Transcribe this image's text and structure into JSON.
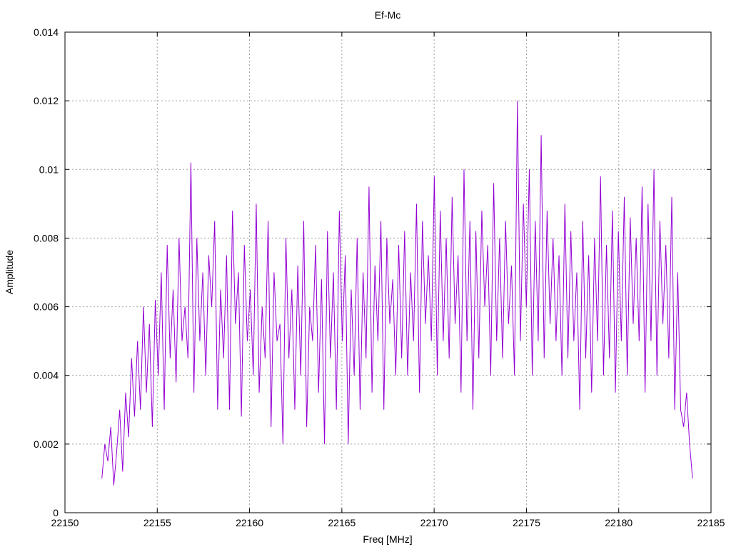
{
  "chart_data": {
    "type": "line",
    "title": "Ef-Mc",
    "xlabel": "Freq [MHz]",
    "ylabel": "Amplitude",
    "xlim": [
      22150,
      22185
    ],
    "ylim": [
      0,
      0.014
    ],
    "xticks": [
      22150,
      22155,
      22160,
      22165,
      22170,
      22175,
      22180,
      22185
    ],
    "yticks": [
      0,
      0.002,
      0.004,
      0.006,
      0.008,
      0.01,
      0.012,
      0.014
    ],
    "ytick_labels": [
      "0",
      "0.002",
      "0.004",
      "0.006",
      "0.008",
      "0.01",
      "0.012",
      "0.014"
    ],
    "grid": true,
    "series_color": "#9400d3",
    "x_range": [
      22152.0,
      22184.0
    ],
    "y": [
      0.001,
      0.002,
      0.0015,
      0.0025,
      0.0008,
      0.0018,
      0.003,
      0.0012,
      0.0035,
      0.0022,
      0.0045,
      0.0028,
      0.005,
      0.003,
      0.006,
      0.0035,
      0.0055,
      0.0025,
      0.0062,
      0.004,
      0.007,
      0.003,
      0.0078,
      0.0045,
      0.0065,
      0.0038,
      0.008,
      0.005,
      0.006,
      0.0045,
      0.0102,
      0.0035,
      0.008,
      0.005,
      0.007,
      0.004,
      0.0075,
      0.006,
      0.0085,
      0.003,
      0.0065,
      0.0045,
      0.0075,
      0.003,
      0.0088,
      0.0055,
      0.007,
      0.0028,
      0.0078,
      0.005,
      0.0065,
      0.004,
      0.009,
      0.0035,
      0.006,
      0.0045,
      0.0085,
      0.0025,
      0.007,
      0.005,
      0.0055,
      0.002,
      0.008,
      0.0045,
      0.0065,
      0.003,
      0.0072,
      0.004,
      0.0085,
      0.0025,
      0.006,
      0.005,
      0.0078,
      0.0035,
      0.0068,
      0.002,
      0.0082,
      0.0045,
      0.007,
      0.003,
      0.0088,
      0.005,
      0.0075,
      0.002,
      0.0065,
      0.004,
      0.008,
      0.003,
      0.007,
      0.0045,
      0.0095,
      0.0035,
      0.0072,
      0.005,
      0.0085,
      0.003,
      0.008,
      0.0055,
      0.0068,
      0.004,
      0.0078,
      0.0045,
      0.0082,
      0.004,
      0.007,
      0.005,
      0.009,
      0.0035,
      0.0085,
      0.0055,
      0.0075,
      0.005,
      0.0098,
      0.004,
      0.0088,
      0.005,
      0.008,
      0.0045,
      0.0092,
      0.0055,
      0.0075,
      0.0035,
      0.01,
      0.005,
      0.0085,
      0.003,
      0.0082,
      0.0045,
      0.0088,
      0.006,
      0.0078,
      0.004,
      0.0096,
      0.005,
      0.008,
      0.0045,
      0.0085,
      0.0055,
      0.0072,
      0.004,
      0.012,
      0.005,
      0.009,
      0.006,
      0.01,
      0.004,
      0.0085,
      0.005,
      0.011,
      0.0045,
      0.0088,
      0.0055,
      0.008,
      0.005,
      0.0075,
      0.004,
      0.009,
      0.0045,
      0.0082,
      0.005,
      0.007,
      0.003,
      0.0085,
      0.0045,
      0.0075,
      0.0035,
      0.008,
      0.005,
      0.0098,
      0.004,
      0.0078,
      0.0045,
      0.0088,
      0.0035,
      0.0082,
      0.005,
      0.0092,
      0.004,
      0.0086,
      0.0055,
      0.008,
      0.005,
      0.0095,
      0.0035,
      0.009,
      0.005,
      0.01,
      0.004,
      0.0085,
      0.0055,
      0.0078,
      0.0045,
      0.0092,
      0.003,
      0.007,
      0.003,
      0.0025,
      0.0035,
      0.002,
      0.001
    ]
  }
}
